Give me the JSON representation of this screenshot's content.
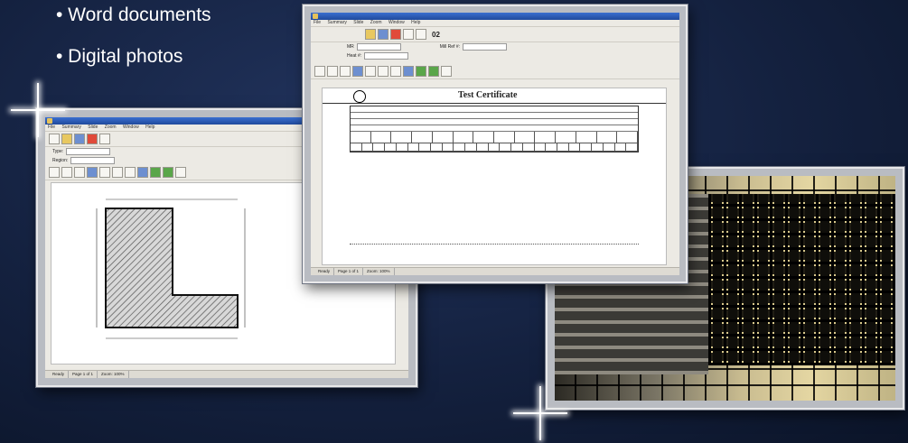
{
  "bullets": [
    "• Word documents",
    "• Digital  photos"
  ],
  "drawing_window": {
    "title": "",
    "menu": [
      "File",
      "Summary",
      "Slide",
      "Zoom",
      "Window",
      "Help"
    ],
    "type_label": "Type:",
    "type_value": "",
    "region_label": "Region:",
    "region_value": "",
    "part_code": "",
    "part_name": "",
    "status_items": [
      "Ready",
      "Page 1 of 1",
      "Zoom: 100%",
      "",
      ""
    ]
  },
  "certificate_window": {
    "title": "",
    "menu": [
      "File",
      "Summary",
      "Slide",
      "Zoom",
      "Window",
      "Help"
    ],
    "counter": "02",
    "mr_label": "MR",
    "heat_label": "Heat #:",
    "mill_label": "Mill Ref #:",
    "doc_title": "Test Certificate",
    "status_items": [
      "Ready",
      "Page 1 of 1",
      "Zoom: 100%",
      "",
      ""
    ]
  },
  "colors": {
    "background": "#14213f",
    "frame": "#b9bcc2",
    "window_bg": "#eceae4"
  }
}
